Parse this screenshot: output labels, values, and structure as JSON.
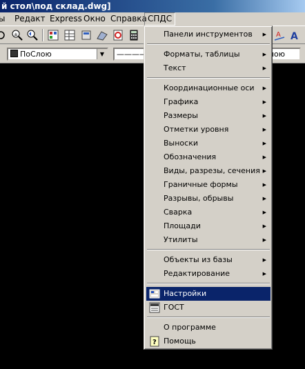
{
  "window": {
    "title": "й стол\\под склад.dwg]"
  },
  "menubar": {
    "items": [
      {
        "label": "ы"
      },
      {
        "label": "Редакт"
      },
      {
        "label": "Express"
      },
      {
        "label": "Окно"
      },
      {
        "label": "Справка"
      },
      {
        "label": "СПДС"
      }
    ]
  },
  "propbar": {
    "layer_combo": "ПоСлою",
    "linetype_combo": "————",
    "right_combo": "лою"
  },
  "spds_menu": {
    "items": [
      {
        "label": "Панели инструментов",
        "submenu": true
      },
      {
        "label": "Форматы, таблицы",
        "submenu": true
      },
      {
        "label": "Текст",
        "submenu": true
      },
      {
        "label": "Координационные оси",
        "submenu": true
      },
      {
        "label": "Графика",
        "submenu": true
      },
      {
        "label": "Размеры",
        "submenu": true
      },
      {
        "label": "Отметки уровня",
        "submenu": true
      },
      {
        "label": "Выноски",
        "submenu": true
      },
      {
        "label": "Обозначения",
        "submenu": true
      },
      {
        "label": "Виды, разрезы, сечения",
        "submenu": true
      },
      {
        "label": "Граничные формы",
        "submenu": true
      },
      {
        "label": "Разрывы, обрывы",
        "submenu": true
      },
      {
        "label": "Сварка",
        "submenu": true
      },
      {
        "label": "Площади",
        "submenu": true
      },
      {
        "label": "Утилиты",
        "submenu": true
      },
      {
        "label": "Объекты из базы",
        "submenu": true
      },
      {
        "label": "Редактирование",
        "submenu": true
      },
      {
        "label": "Настройки",
        "submenu": false,
        "highlighted": true,
        "icon": "settings-icon"
      },
      {
        "label": "ГОСТ",
        "submenu": false,
        "icon": "gost-icon"
      },
      {
        "label": "О программе",
        "submenu": false
      },
      {
        "label": "Помощь",
        "submenu": false,
        "icon": "help-icon"
      }
    ],
    "submenu_arrow": "▶",
    "highlight_color": "#0a246a"
  }
}
